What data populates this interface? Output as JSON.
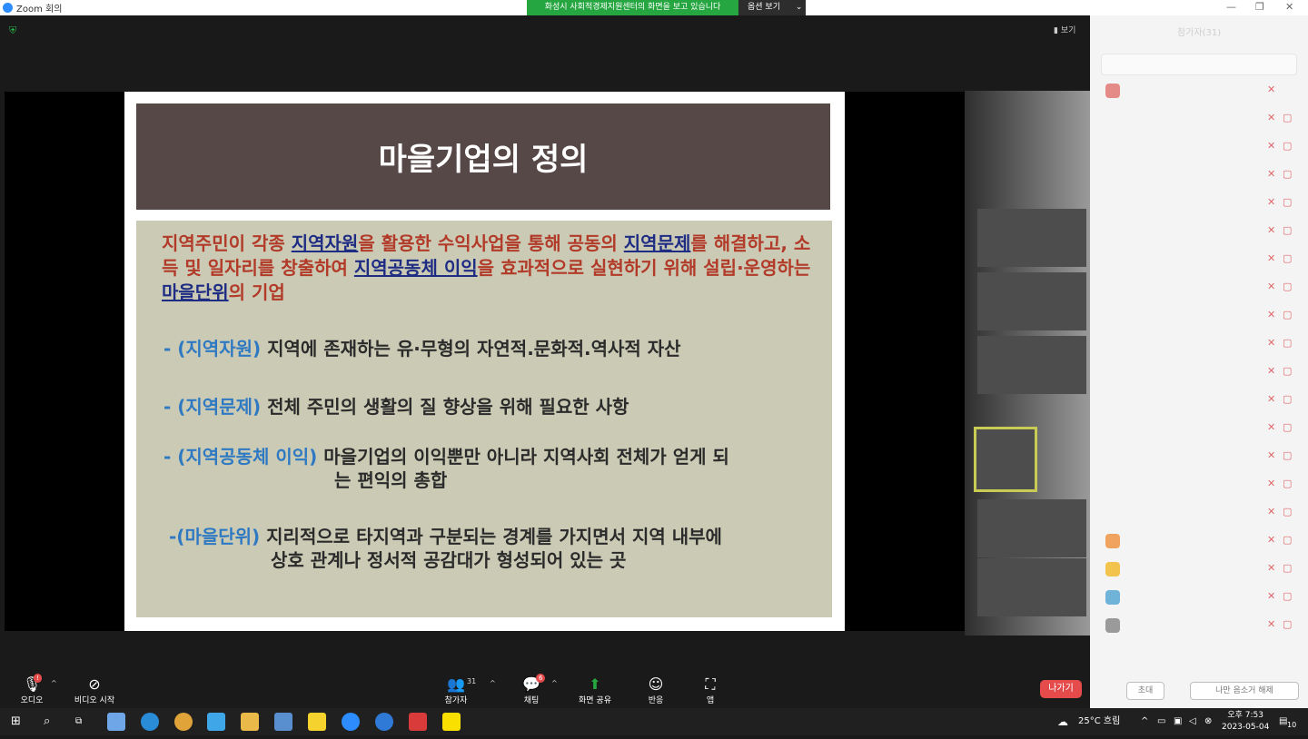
{
  "window": {
    "title": "Zoom 회의",
    "share_banner": "화성시 사회적경제지원센터의 화면을 보고 있습니다",
    "view_options": "옵션 보기",
    "minimize": "—",
    "maximize": "❐",
    "close": "✕"
  },
  "view_button": "보기",
  "slide": {
    "title": "마을기업의 정의",
    "definition": {
      "p1": "지역주민이 각종 ",
      "u1": "지역자원",
      "p2": "을 활용한 수익사업을 통해 공동의 ",
      "u2": "지역문제",
      "p3": "를 해결하고, 소득 및 일자리를 창출하여 ",
      "u3": "지역공동체 이익",
      "p4": "을 효과적으로 실현하기 위해 설립·운영하는 ",
      "u4": "마을단위",
      "p5": "의 기업"
    },
    "items": [
      {
        "label": "- (지역자원)",
        "text": " 지역에 존재하는 유·무형의 자연적.문화적.역사적 자산"
      },
      {
        "label": "- (지역문제)",
        "text": " 전체 주민의 생활의 질 향상을 위해 필요한 사항"
      },
      {
        "label": "- (지역공동체 이익)",
        "text": " 마을기업의 이익뿐만 아니라 지역사회 전체가 얻게 되",
        "text2": "는 편익의 총합"
      },
      {
        "label": "-(마을단위)",
        "text": " 지리적으로 타지역과 구분되는 경계를 가지면서 지역 내부에",
        "text2": "상호 관계나 정서적 공감대가 형성되어 있는 곳"
      }
    ]
  },
  "panel": {
    "title": "참가자(31)",
    "invite": "초대",
    "unmute_me": "나만 음소거 해제"
  },
  "toolbar": {
    "audio": "오디오",
    "audio_badge": "!",
    "video": "비디오 시작",
    "participants": "참가자",
    "participants_count": "31",
    "chat": "채팅",
    "chat_badge": "6",
    "share": "화면 공유",
    "reactions": "반응",
    "apps": "앱",
    "leave": "나가기"
  },
  "taskbar": {
    "weather": "25°C 흐림",
    "time": "오후 7:53",
    "date": "2023-05-04",
    "notifications": "10"
  },
  "colors": {
    "title_bar": "#574848",
    "body_bg": "#cbcbb5",
    "definition_text": "#b23a29",
    "underline_text": "#1f2c84",
    "item_label": "#2f79c3",
    "share_green": "#26a641",
    "leave_red": "#e64b4b"
  }
}
